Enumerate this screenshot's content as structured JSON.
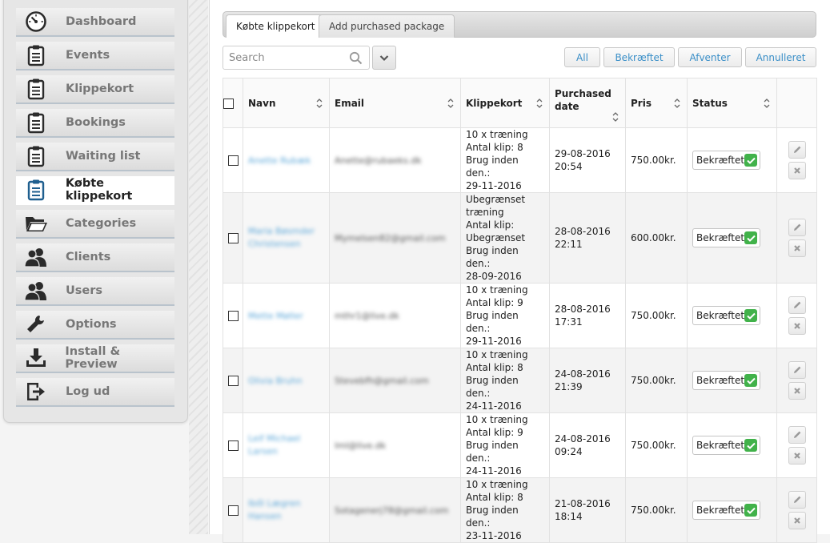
{
  "sidebar": {
    "items": [
      {
        "label": "Dashboard",
        "icon": "gauge-icon",
        "active": false
      },
      {
        "label": "Events",
        "icon": "clipboard-icon",
        "active": false
      },
      {
        "label": "Klippekort",
        "icon": "clipboard-icon",
        "active": false
      },
      {
        "label": "Bookings",
        "icon": "clipboard-icon",
        "active": false
      },
      {
        "label": "Waiting list",
        "icon": "clipboard-icon",
        "active": false
      },
      {
        "label": "Købte klippekort",
        "icon": "clipboard-icon",
        "active": true
      },
      {
        "label": "Categories",
        "icon": "folder-icon",
        "active": false
      },
      {
        "label": "Clients",
        "icon": "users-icon",
        "active": false
      },
      {
        "label": "Users",
        "icon": "users-icon",
        "active": false
      },
      {
        "label": "Options",
        "icon": "wrench-icon",
        "active": false
      },
      {
        "label": "Install & Preview",
        "icon": "download-icon",
        "active": false
      },
      {
        "label": "Log ud",
        "icon": "logout-icon",
        "active": false
      }
    ]
  },
  "tabs": [
    {
      "label": "Købte klippekort",
      "active": true
    },
    {
      "label": "Add purchased package",
      "active": false
    }
  ],
  "search": {
    "placeholder": "Search",
    "value": ""
  },
  "filters": [
    "All",
    "Bekræftet",
    "Afventer",
    "Annulleret"
  ],
  "columns": {
    "name": "Navn",
    "email": "Email",
    "package": "Klippekort",
    "purchased": "Purchased date",
    "price": "Pris",
    "status": "Status"
  },
  "rows": [
    {
      "name": "Anette Rubæk",
      "email": "Anette@rubaeks.dk",
      "package": [
        "10 x træning",
        "Antal klip: 8",
        "Brug inden den.:",
        "29-11-2016"
      ],
      "date": [
        "29-08-2016",
        "20:54"
      ],
      "price": "750.00kr.",
      "status": "Bekræftet"
    },
    {
      "name": "Maria Bøsmder Christensen",
      "email": "Mymelsen82@gmail.com",
      "package": [
        "Ubegrænset",
        "træning",
        "Antal klip:",
        "Ubegrænset",
        "Brug inden den.:",
        "28-09-2016"
      ],
      "date": [
        "28-08-2016",
        "22:11"
      ],
      "price": "600.00kr.",
      "status": "Bekræftet"
    },
    {
      "name": "Mette Møller",
      "email": "mthr1@live.dk",
      "package": [
        "10 x træning",
        "Antal klip: 9",
        "Brug inden den.:",
        "29-11-2016"
      ],
      "date": [
        "28-08-2016",
        "17:31"
      ],
      "price": "750.00kr.",
      "status": "Bekræftet"
    },
    {
      "name": "Olivia Bruhn",
      "email": "Stevebfh@gmail.com",
      "package": [
        "10 x træning",
        "Antal klip: 8",
        "Brug inden den.:",
        "24-11-2016"
      ],
      "date": [
        "24-08-2016",
        "21:39"
      ],
      "price": "750.00kr.",
      "status": "Bekræftet"
    },
    {
      "name": "Leif Michael Larsen",
      "email": "lml@live.dk",
      "package": [
        "10 x træning",
        "Antal klip: 9",
        "Brug inden den.:",
        "24-11-2016"
      ],
      "date": [
        "24-08-2016",
        "09:24"
      ],
      "price": "750.00kr.",
      "status": "Bekræftet"
    },
    {
      "name": "Iből Lægren Hansen",
      "email": "Sotagenerj78@gmail.com",
      "package": [
        "10 x træning",
        "Antal klip: 8",
        "Brug inden den.:",
        "23-11-2016"
      ],
      "date": [
        "21-08-2016",
        "18:14"
      ],
      "price": "750.00kr.",
      "status": "Bekræftet"
    }
  ],
  "colors": {
    "accent": "#3a8fc8",
    "ok": "#41b24a",
    "name_link": "#5aa6d8"
  }
}
